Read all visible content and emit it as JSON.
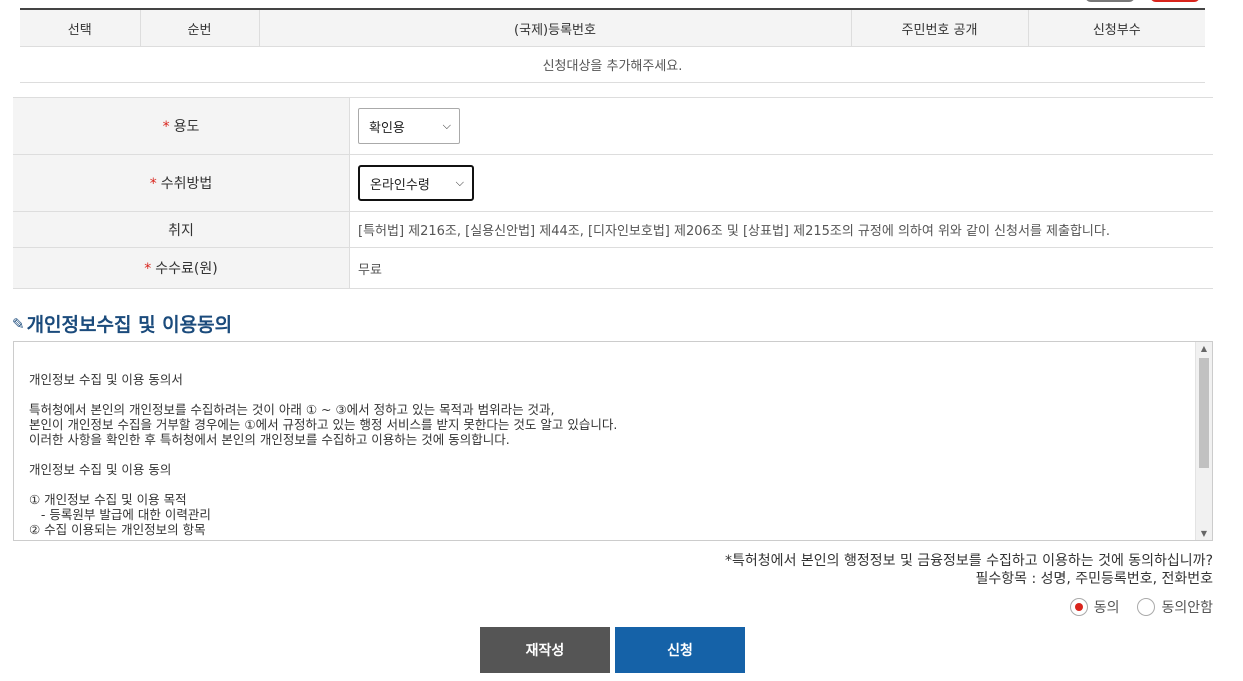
{
  "target_table": {
    "headers": [
      "선택",
      "순번",
      "(국제)등록번호",
      "주민번호 공개",
      "신청부수"
    ],
    "empty_message": "신청대상을 추가해주세요."
  },
  "form": {
    "usage": {
      "label": "용도",
      "value": "확인용"
    },
    "receive_method": {
      "label": "수취방법",
      "value": "온라인수령"
    },
    "notice": {
      "label": "취지",
      "value": "[특허법] 제216조, [실용신안법] 제44조, [디자인보호법] 제206조 및 [상표법] 제215조의 규정에 의하여 위와 같이 신청서를 제출합니다."
    },
    "fee": {
      "label": "수수료(원)",
      "value": "무료"
    },
    "required_mark": "*"
  },
  "privacy": {
    "title": "개인정보수집 및 이용동의",
    "text": "개인정보 수집 및 이용 동의서\n\n특허청에서 본인의 개인정보를 수집하려는 것이 아래 ① ~ ③에서 정하고 있는 목적과 범위라는 것과,\n본인이 개인정보 수집을 거부할 경우에는 ①에서 규정하고 있는 행정 서비스를 받지 못한다는 것도 알고 있습니다.\n이러한 사항을 확인한 후 특허청에서 본인의 개인정보를 수집하고 이용하는 것에 동의합니다.\n\n개인정보 수집 및 이용 동의\n\n① 개인정보 수집 및 이용 목적\n   - 등록원부 발급에 대한 이력관리\n② 수집 이용되는 개인정보의 항목",
    "question": "*특허청에서 본인의 행정정보 및 금융정보를 수집하고 이용하는 것에 동의하십니까?",
    "required_items": "필수항목 : 성명, 주민등록번호, 전화번호",
    "options": {
      "agree": "동의",
      "disagree": "동의안함"
    }
  },
  "buttons": {
    "rewrite": "재작성",
    "submit": "신청"
  }
}
